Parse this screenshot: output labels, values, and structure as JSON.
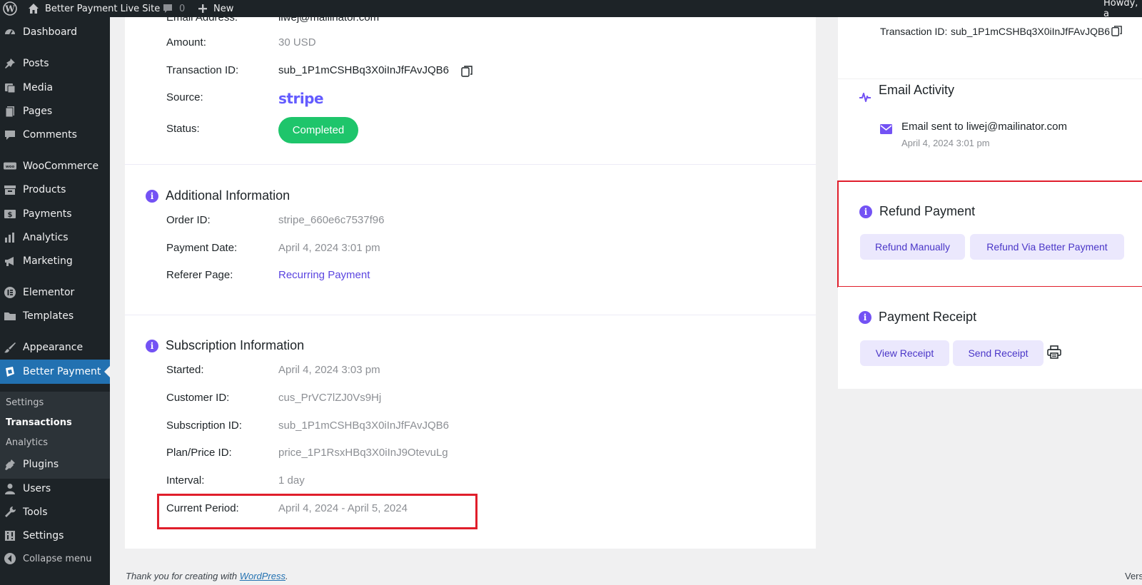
{
  "admin_bar": {
    "site_name": "Better Payment Live Site",
    "comments_count": "0",
    "new_label": "New",
    "howdy": "Howdy, a"
  },
  "sidebar": {
    "items": [
      {
        "label": "Dashboard",
        "icon": "dashboard-icon"
      },
      {
        "label": "Posts",
        "icon": "pin-icon"
      },
      {
        "label": "Media",
        "icon": "media-icon"
      },
      {
        "label": "Pages",
        "icon": "pages-icon"
      },
      {
        "label": "Comments",
        "icon": "comment-icon"
      },
      {
        "label": "WooCommerce",
        "icon": "woo-icon"
      },
      {
        "label": "Products",
        "icon": "archive-icon"
      },
      {
        "label": "Payments",
        "icon": "dollar-icon"
      },
      {
        "label": "Analytics",
        "icon": "bar-chart-icon"
      },
      {
        "label": "Marketing",
        "icon": "megaphone-icon"
      },
      {
        "label": "Elementor",
        "icon": "elementor-icon"
      },
      {
        "label": "Templates",
        "icon": "folder-icon"
      },
      {
        "label": "Appearance",
        "icon": "brush-icon"
      },
      {
        "label": "Better Payment",
        "icon": "better-payment-icon"
      },
      {
        "label": "Plugins",
        "icon": "plugin-icon"
      },
      {
        "label": "Users",
        "icon": "user-icon"
      },
      {
        "label": "Tools",
        "icon": "wrench-icon"
      },
      {
        "label": "Settings",
        "icon": "settings-icon"
      },
      {
        "label": "Collapse menu",
        "icon": "collapse-icon"
      }
    ],
    "submenu": {
      "settings": "Settings",
      "transactions": "Transactions",
      "analytics": "Analytics"
    }
  },
  "payment_details": {
    "email_label": "Email Address:",
    "email_value": "liwej@mailinator.com",
    "amount_label": "Amount:",
    "amount_value": "30 USD",
    "txn_label": "Transaction ID:",
    "txn_value": "sub_1P1mCSHBq3X0iInJfFAvJQB6",
    "source_label": "Source:",
    "source_value": "stripe",
    "status_label": "Status:",
    "status_value": "Completed"
  },
  "additional_info": {
    "title": "Additional Information",
    "order_id_label": "Order ID:",
    "order_id_value": "stripe_660e6c7537f96",
    "payment_date_label": "Payment Date:",
    "payment_date_value": "April 4, 2024 3:01 pm",
    "referer_label": "Referer Page:",
    "referer_value": "Recurring Payment"
  },
  "subscription_info": {
    "title": "Subscription Information",
    "started_label": "Started:",
    "started_value": "April 4, 2024 3:03 pm",
    "customer_label": "Customer ID:",
    "customer_value": "cus_PrVC7lZJ0Vs9Hj",
    "subscription_label": "Subscription ID:",
    "subscription_value": "sub_1P1mCSHBq3X0iInJfFAvJQB6",
    "plan_label": "Plan/Price ID:",
    "plan_value": "price_1P1RsxHBq3X0iInJ9OtevuLg",
    "interval_label": "Interval:",
    "interval_value": "1 day",
    "period_label": "Current Period:",
    "period_value": "April 4, 2024 - April 5, 2024"
  },
  "right_panel": {
    "txn_label": "Transaction ID:",
    "txn_value": "sub_1P1mCSHBq3X0iInJfFAvJQB6",
    "email_activity_title": "Email Activity",
    "email_sent": "Email sent to liwej@mailinator.com",
    "email_sent_date": "April 4, 2024 3:01 pm",
    "refund_title": "Refund Payment",
    "refund_manual": "Refund Manually",
    "refund_via": "Refund Via Better Payment",
    "receipt_title": "Payment Receipt",
    "view_receipt": "View Receipt",
    "send_receipt": "Send Receipt"
  },
  "footer": {
    "prefix": "Thank you for creating with ",
    "link": "WordPress",
    "suffix": ".",
    "version": "Vers"
  },
  "colors": {
    "accent": "#7352f4",
    "status_completed": "#1ec56b",
    "highlight": "#e01e2b",
    "admin_active": "#2271b1"
  }
}
